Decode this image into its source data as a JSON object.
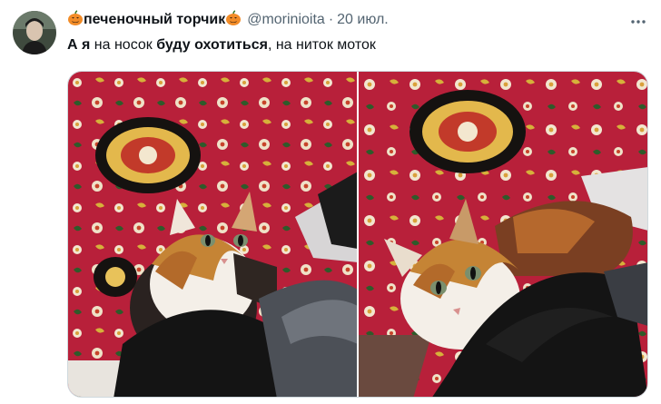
{
  "tweet": {
    "author_name": "печеночный торчик",
    "handle": "@morinioita",
    "separator": "·",
    "date": "20 июл.",
    "text_parts": {
      "p1": "А я",
      "p2": " на носок ",
      "p3": "буду охотиться",
      "p4": ", на ниток моток"
    }
  },
  "icons": {
    "name_prefix": "pumpkin-emoji",
    "name_suffix": "pumpkin-emoji",
    "menu": "more-horizontal-icon"
  },
  "colors": {
    "text": "#0f1419",
    "secondary": "#536471",
    "rug_red": "#b8203a",
    "pumpkin": "#f28c28"
  }
}
